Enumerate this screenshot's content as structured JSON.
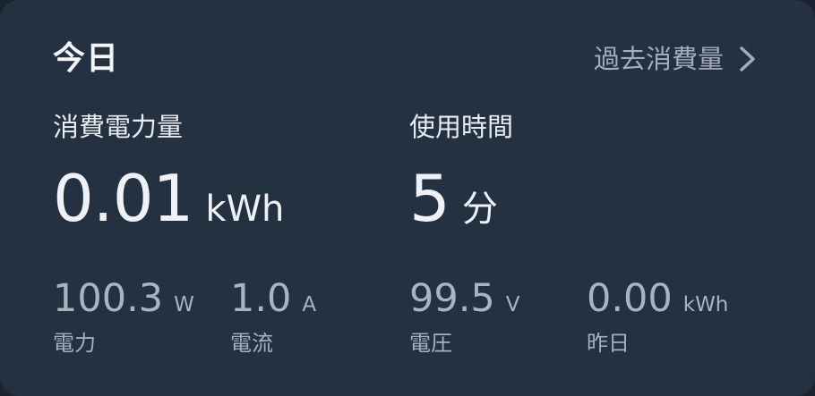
{
  "card": {
    "title": "今日",
    "history_link": {
      "label": "過去消費量",
      "icon": "chevron-right-icon"
    }
  },
  "primary_metrics": {
    "energy": {
      "label": "消費電力量",
      "value": "0.01",
      "unit": "kWh"
    },
    "usage_time": {
      "label": "使用時間",
      "value": "5",
      "unit": "分"
    }
  },
  "secondary_metrics": {
    "power": {
      "value": "100.3",
      "unit": "W",
      "label": "電力"
    },
    "current": {
      "value": "1.0",
      "unit": "A",
      "label": "電流"
    },
    "voltage": {
      "value": "99.5",
      "unit": "V",
      "label": "電圧"
    },
    "yesterday": {
      "value": "0.00",
      "unit": "kWh",
      "label": "昨日"
    }
  },
  "colors": {
    "card_background": "#243141",
    "primary_text": "#eef1f5",
    "secondary_text": "#a6b0bd"
  }
}
